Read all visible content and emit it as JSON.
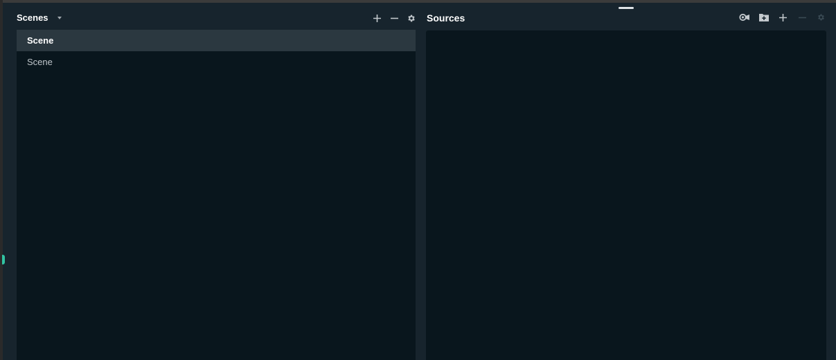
{
  "scenes": {
    "title": "Scenes",
    "items": [
      {
        "label": "Scene",
        "active": true
      },
      {
        "label": "Scene",
        "active": false
      }
    ],
    "icons": [
      "plus-icon",
      "minus-icon",
      "gear-icon",
      "chevron-down-icon"
    ]
  },
  "sources": {
    "title": "Sources",
    "icons": [
      "selective-recording-icon",
      "add-folder-icon",
      "plus-icon",
      "minus-icon",
      "gear-icon"
    ],
    "items": []
  },
  "colors": {
    "panel_bg": "#17242d",
    "list_bg": "#09161d",
    "selected_row": "#2b3840",
    "accent": "#31c3a2"
  }
}
